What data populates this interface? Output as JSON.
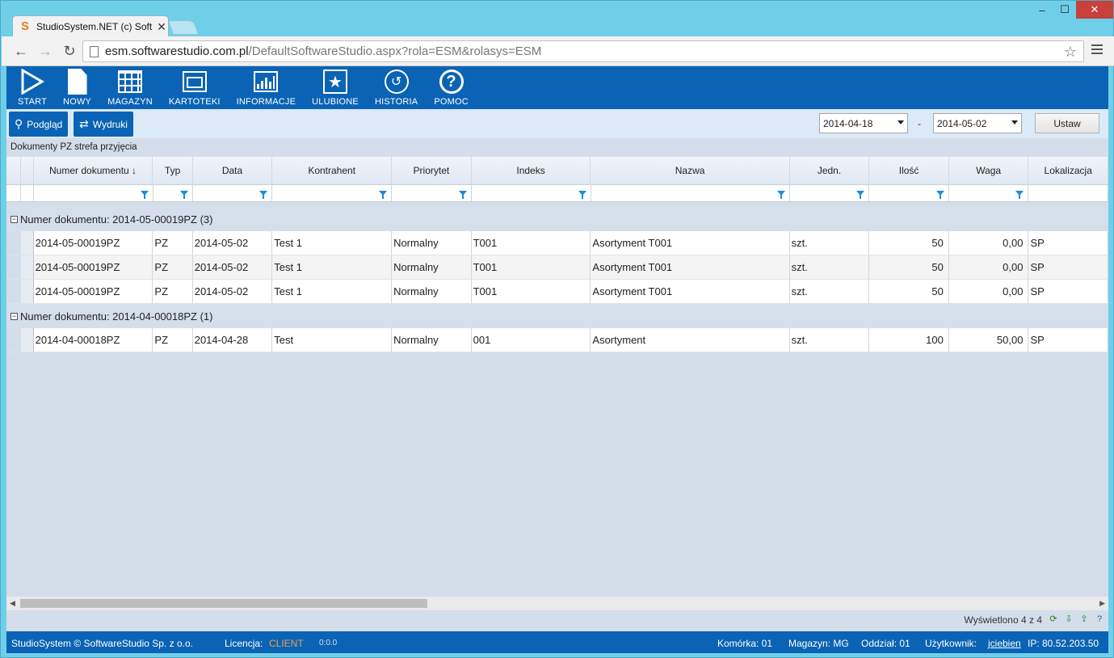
{
  "browser": {
    "tab_title": "StudioSystem.NET (c) Soft",
    "tab_logo": "S",
    "url_host": "esm.softwarestudio.com.pl",
    "url_path": "/DefaultSoftwareStudio.aspx?rola=ESM&rolasys=ESM"
  },
  "toolbar": {
    "items": [
      {
        "label": "START",
        "icon": "play-icon"
      },
      {
        "label": "NOWY",
        "icon": "new-document-icon"
      },
      {
        "label": "MAGAZYN",
        "icon": "warehouse-grid-icon"
      },
      {
        "label": "KARTOTEKI",
        "icon": "card-index-icon"
      },
      {
        "label": "INFORMACJE",
        "icon": "chart-icon"
      },
      {
        "label": "ULUBIONE",
        "icon": "star-icon"
      },
      {
        "label": "HISTORIA",
        "icon": "history-icon"
      },
      {
        "label": "POMOC",
        "icon": "help-icon"
      }
    ]
  },
  "subbar": {
    "preview_label": "Podgląd",
    "prints_label": "Wydruki",
    "date_from": "2014-04-18",
    "date_sep": "-",
    "date_to": "2014-05-02",
    "set_label": "Ustaw"
  },
  "grid": {
    "caption": "Dokumenty PZ strefa przyjęcia",
    "columns": [
      "Numer dokumentu ↓",
      "Typ",
      "Data",
      "Kontrahent",
      "Priorytet",
      "Indeks",
      "Nazwa",
      "Jedn.",
      "Ilość",
      "Waga",
      "Lokalizacja"
    ],
    "groups": [
      {
        "label": "Numer dokumentu: 2014-05-00019PZ (3)",
        "rows": [
          [
            "2014-05-00019PZ",
            "PZ",
            "2014-05-02",
            "Test 1",
            "Normalny",
            "T001",
            "Asortyment T001",
            "szt.",
            "50",
            "0,00",
            "SP"
          ],
          [
            "2014-05-00019PZ",
            "PZ",
            "2014-05-02",
            "Test 1",
            "Normalny",
            "T001",
            "Asortyment T001",
            "szt.",
            "50",
            "0,00",
            "SP"
          ],
          [
            "2014-05-00019PZ",
            "PZ",
            "2014-05-02",
            "Test 1",
            "Normalny",
            "T001",
            "Asortyment T001",
            "szt.",
            "50",
            "0,00",
            "SP"
          ]
        ]
      },
      {
        "label": "Numer dokumentu: 2014-04-00018PZ (1)",
        "rows": [
          [
            "2014-04-00018PZ",
            "PZ",
            "2014-04-28",
            "Test",
            "Normalny",
            "001",
            "Asortyment",
            "szt.",
            "100",
            "50,00",
            "SP"
          ]
        ]
      }
    ],
    "displayed": "Wyświetlono 4 z 4"
  },
  "status": {
    "copyright": "StudioSystem © SoftwareStudio Sp. z o.o.",
    "license_label": "Licencja:",
    "license_value": "CLIENT",
    "timer": "0:0.0",
    "cell": "Komórka: 01",
    "warehouse": "Magazyn: MG",
    "branch": "Oddział: 01",
    "user_label": "Użytkownik:",
    "user": "jciebien",
    "ip": "IP: 80.52.203.50"
  }
}
